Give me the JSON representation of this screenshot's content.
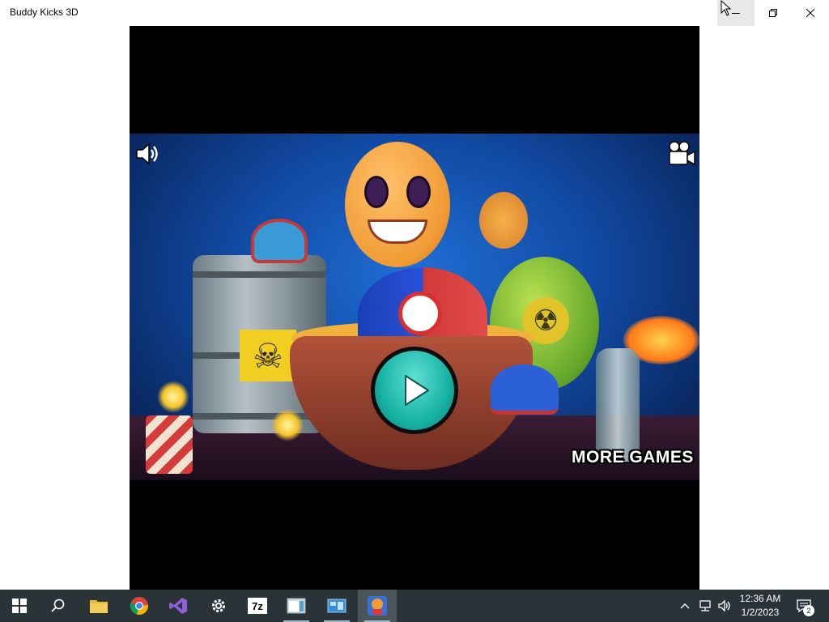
{
  "window": {
    "title": "Buddy Kicks 3D",
    "controls": [
      "minimize",
      "restore",
      "close"
    ]
  },
  "game": {
    "more_games_label": "MORE GAMES",
    "icons": [
      "sound-icon",
      "video-camera-icon",
      "play-icon"
    ]
  },
  "taskbar": {
    "items": [
      {
        "name": "start",
        "icon": "windows-logo-icon"
      },
      {
        "name": "search",
        "icon": "search-icon"
      },
      {
        "name": "file-explorer",
        "icon": "folder-icon"
      },
      {
        "name": "chrome",
        "icon": "chrome-icon"
      },
      {
        "name": "visual-studio",
        "icon": "visual-studio-icon"
      },
      {
        "name": "settings",
        "icon": "gear-icon"
      },
      {
        "name": "7zip",
        "icon": "7zip-icon",
        "label": "7z"
      },
      {
        "name": "app-window",
        "icon": "window-icon"
      },
      {
        "name": "control-panel",
        "icon": "control-panel-icon"
      },
      {
        "name": "buddy-kicks",
        "icon": "buddy-kicks-icon"
      }
    ],
    "clock": {
      "time": "12:36 AM",
      "date": "1/2/2023"
    },
    "notification_count": "2"
  },
  "colors": {
    "taskbar_bg": "#2a3338",
    "play_button": "#17b3a6",
    "game_bg": "#114aa3"
  }
}
